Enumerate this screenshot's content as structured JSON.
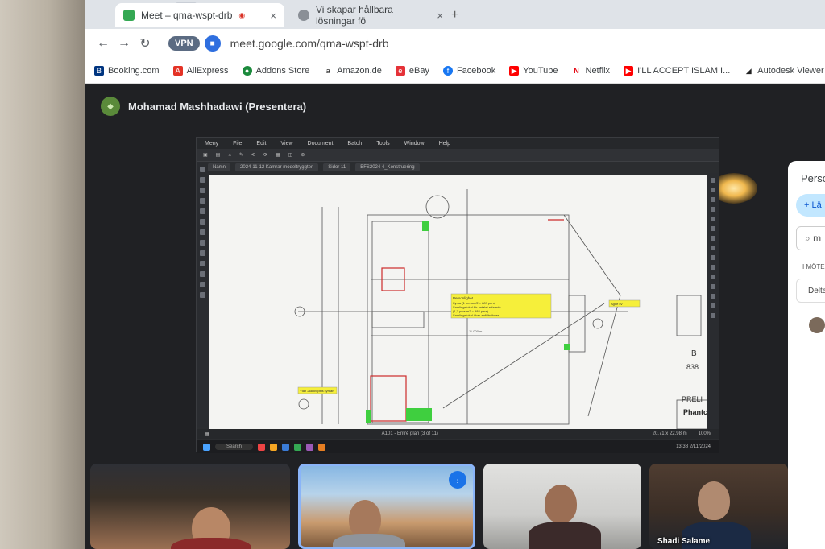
{
  "browser": {
    "tabs": [
      {
        "label": "Meet – qma-wspt-drb",
        "close": "×",
        "color": "#34a853"
      },
      {
        "label": "Vi skapar hållbara lösningar fö",
        "close": "×",
        "color": "#5f6368"
      }
    ],
    "new_tab": "+",
    "tab_menu_icon": "chevron-down-icon",
    "vpn_badge": "VPN",
    "url": "meet.google.com/qma-wspt-drb",
    "bookmarks": [
      {
        "label": "Booking.com",
        "color": "#003580"
      },
      {
        "label": "AliExpress",
        "color": "#e43225"
      },
      {
        "label": "Addons Store",
        "color": "#1b8a3c"
      },
      {
        "label": "Amazon.de",
        "color": "#222222"
      },
      {
        "label": "eBay",
        "color": "#e53238"
      },
      {
        "label": "Facebook",
        "color": "#1877f2"
      },
      {
        "label": "YouTube",
        "color": "#ff0000"
      },
      {
        "label": "Netflix",
        "color": "#e50914"
      },
      {
        "label": "I'LL ACCEPT ISLAM I...",
        "color": "#ff0000"
      },
      {
        "label": "Autodesk Viewer | F...",
        "color": "#222222"
      }
    ]
  },
  "meet": {
    "presenter_label": "Mohamad Mashhadawi (Presentera)",
    "people_panel": {
      "title": "Perso",
      "add_label": "Lä",
      "search_text": "m",
      "section_label": "I MÖTE",
      "participants_label": "Delta"
    },
    "tiles": [
      {
        "name": ""
      },
      {
        "name": ""
      },
      {
        "name": ""
      },
      {
        "name": "Shadi Salame"
      }
    ]
  },
  "shared_app": {
    "menu": [
      "Meny",
      "File",
      "Edit",
      "View",
      "Document",
      "Batch",
      "Tools",
      "Window",
      "Help"
    ],
    "doc_tabs": [
      "Namn",
      "2024-11-12 Kamrar modeltryggten",
      "Sidor 11",
      "BFS2024 4_Konstruering"
    ],
    "page_indicator": "A101 - Entré plan (3 of 11)",
    "status_right": "20.71 x 22.98 m",
    "zoom": "100%",
    "drawing": {
      "note1": "Personlighet",
      "note1_lines": [
        "Kyrka (1 person/2 = 88? pers)",
        "Samlingslokal för antalet erfarede",
        "(1,7 pers/m2 = 988 pers)",
        "Samlingslokal ökas anfältsökner"
      ],
      "note2": "Ytan 268 kv plus kyrkan",
      "note3": "Ägde kv",
      "titleblock_b": "B",
      "titleblock_num": "838.",
      "prel": "PRELI",
      "firm": "Phantc",
      "dimension": "11 000 m"
    },
    "taskbar": {
      "search": "Search",
      "time": "13:38",
      "date": "2/11/2024"
    }
  }
}
